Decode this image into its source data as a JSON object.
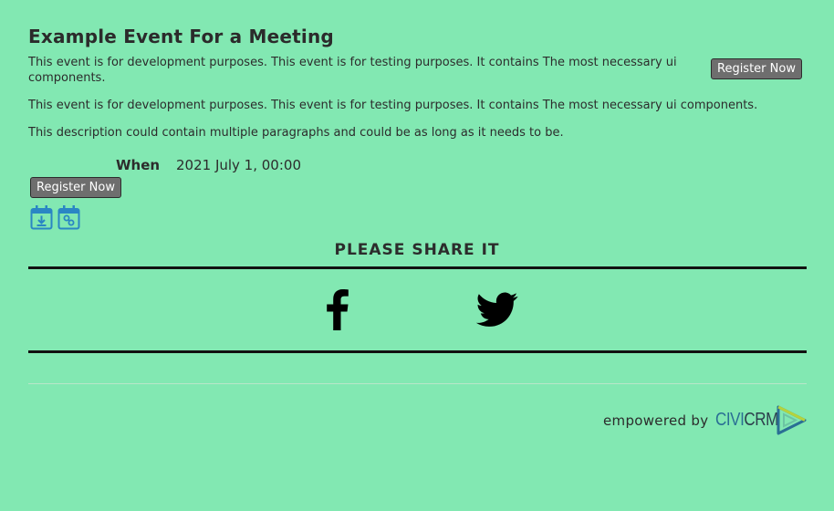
{
  "event": {
    "title": "Example Event For a Meeting",
    "summary": "This event is for development purposes. This event is for testing purposes. It contains The most necessary ui components.",
    "description": [
      "This event is for development purposes. This event is for testing purposes. It contains The most necessary ui components.",
      "This description could contain multiple paragraphs and could be as long as it needs to be."
    ],
    "when_label": "When",
    "when_value": "2021 July 1, 00:00"
  },
  "buttons": {
    "register_top": "Register Now",
    "register_bottom": "Register Now"
  },
  "calendar_icons": [
    "calendar-download-icon",
    "calendar-link-icon"
  ],
  "share": {
    "title": "PLEASE SHARE IT",
    "icons": [
      "facebook-icon",
      "twitter-icon"
    ]
  },
  "footer": {
    "powered_text": "empowered by",
    "logo_civi": "CIVI",
    "logo_crm": "CRM"
  },
  "colors": {
    "background": "#82e8b2",
    "button": "#6e6e6e",
    "icon_blue": "#2a86c4",
    "logo_blue": "#2a6f94"
  }
}
